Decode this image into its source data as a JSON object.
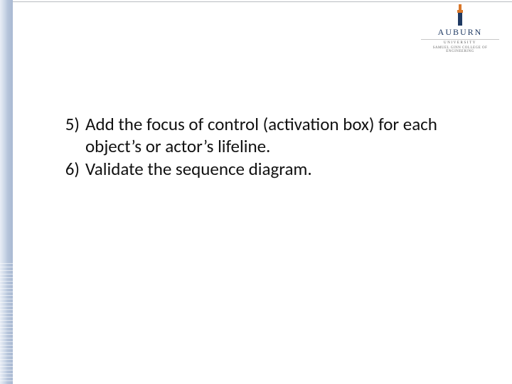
{
  "logo": {
    "word": "AUBURN",
    "sub1": "UNIVERSITY",
    "sub2": "SAMUEL GINN COLLEGE OF ENGINEERING"
  },
  "list": {
    "items": [
      {
        "num": "5)",
        "text": "Add the focus of control (activation box) for each object’s or actor’s lifeline."
      },
      {
        "num": "6)",
        "text": "Validate the sequence diagram."
      }
    ]
  }
}
